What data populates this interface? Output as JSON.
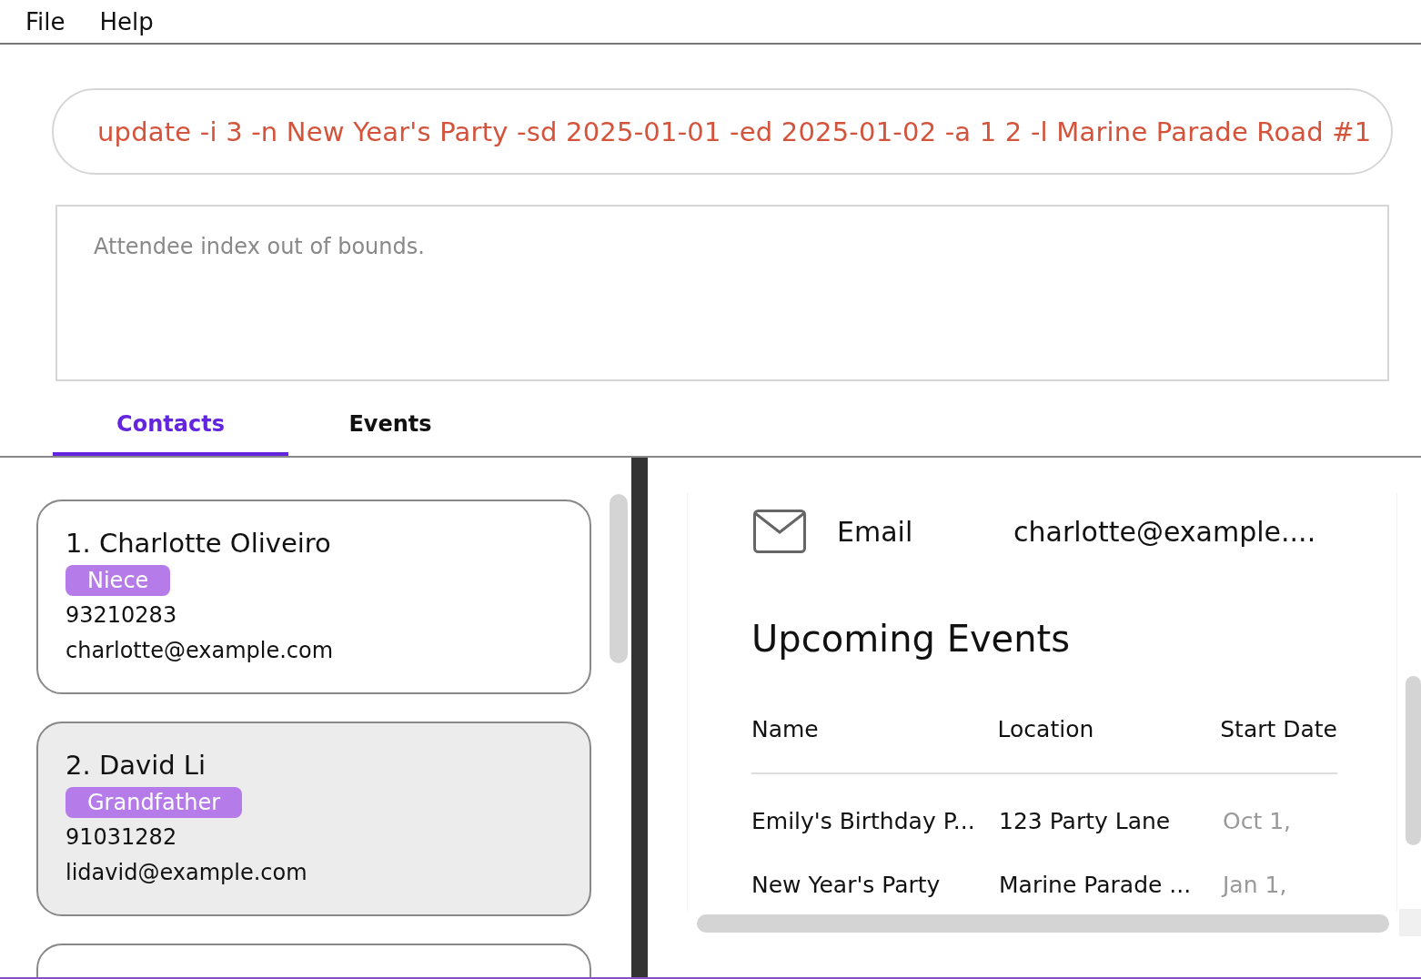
{
  "menu": [
    "File",
    "Help"
  ],
  "command": {
    "value": "update -i 3 -n New Year's Party -sd 2025-01-01 -ed 2025-01-02 -a 1 2 -l Marine Parade Road #1"
  },
  "result": "Attendee index out of bounds.",
  "tabs": [
    {
      "label": "Contacts",
      "selected": true
    },
    {
      "label": "Events",
      "selected": false
    }
  ],
  "contacts": [
    {
      "name": "1. Charlotte Oliveiro",
      "tag": "Niece",
      "phone": "93210283",
      "email": "charlotte@example.com",
      "selected": false
    },
    {
      "name": "2. David Li",
      "tag": "Grandfather",
      "phone": "91031282",
      "email": "lidavid@example.com",
      "selected": true
    },
    {
      "selected": false
    }
  ],
  "detail": {
    "email_label": "Email",
    "email_value": "charlotte@example....",
    "events_heading": "Upcoming Events",
    "columns": [
      "Name",
      "Location",
      "Start Date"
    ],
    "rows": [
      [
        "Emily's Birthday P...",
        "123 Party Lane",
        "Oct 1,"
      ],
      [
        "New Year's Party",
        "Marine Parade ...",
        "Jan 1,"
      ]
    ]
  }
}
